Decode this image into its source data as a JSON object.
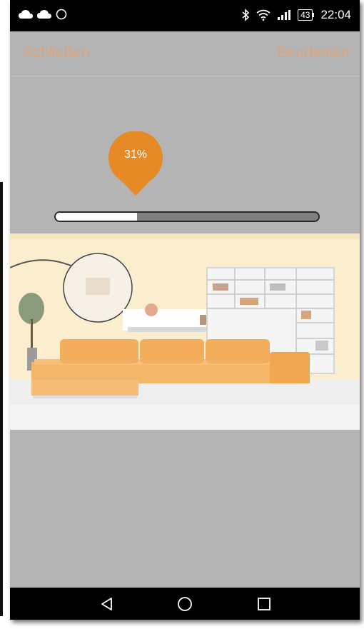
{
  "status_bar": {
    "battery": "43",
    "time": "22:04",
    "left_icons": [
      "cloud-icon",
      "cloud-icon",
      "sync-icon"
    ],
    "right_icons": [
      "bluetooth-icon",
      "wifi-icon",
      "signal-icon",
      "battery-icon"
    ]
  },
  "topbar": {
    "close_label": "Schließen",
    "edit_label": "Bearbeiten"
  },
  "slider": {
    "label": "31%",
    "value": 0.31,
    "accent_color": "#e58a25"
  },
  "colors": {
    "background": "#b4b4b4",
    "button_text": "#dba67b"
  },
  "nav_bar": {
    "icons": [
      "back-icon",
      "home-icon",
      "recents-icon"
    ]
  }
}
